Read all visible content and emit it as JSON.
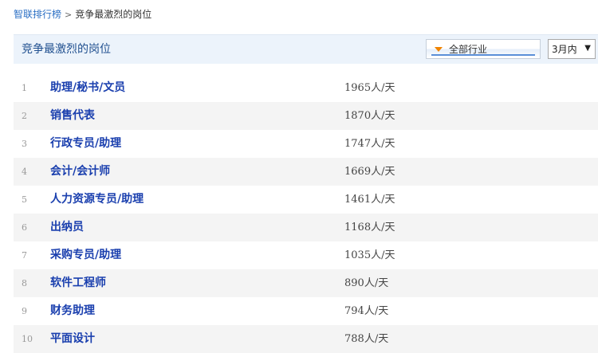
{
  "breadcrumb": {
    "root": "智联排行榜",
    "separator": ">",
    "current": "竞争最激烈的岗位"
  },
  "panel": {
    "title": "竞争最激烈的岗位",
    "industry_select": {
      "value": "全部行业",
      "icon": "triangle-down-icon",
      "accent": "#f08300"
    },
    "period_select": {
      "value": "3月内",
      "caret": "▼"
    }
  },
  "colors": {
    "link": "#2b6fc4",
    "title": "#1f4f8f",
    "job": "#1a3fae",
    "header_bg": "#ecf3fb",
    "alt_row": "#f4f4f4"
  },
  "rankings": [
    {
      "rank": "1",
      "title": "助理/秘书/文员",
      "value": "1965人/天"
    },
    {
      "rank": "2",
      "title": "销售代表",
      "value": "1870人/天"
    },
    {
      "rank": "3",
      "title": "行政专员/助理",
      "value": "1747人/天"
    },
    {
      "rank": "4",
      "title": "会计/会计师",
      "value": "1669人/天"
    },
    {
      "rank": "5",
      "title": "人力资源专员/助理",
      "value": "1461人/天"
    },
    {
      "rank": "6",
      "title": "出纳员",
      "value": "1168人/天"
    },
    {
      "rank": "7",
      "title": "采购专员/助理",
      "value": "1035人/天"
    },
    {
      "rank": "8",
      "title": "软件工程师",
      "value": "890人/天"
    },
    {
      "rank": "9",
      "title": "财务助理",
      "value": "794人/天"
    },
    {
      "rank": "10",
      "title": "平面设计",
      "value": "788人/天"
    }
  ]
}
